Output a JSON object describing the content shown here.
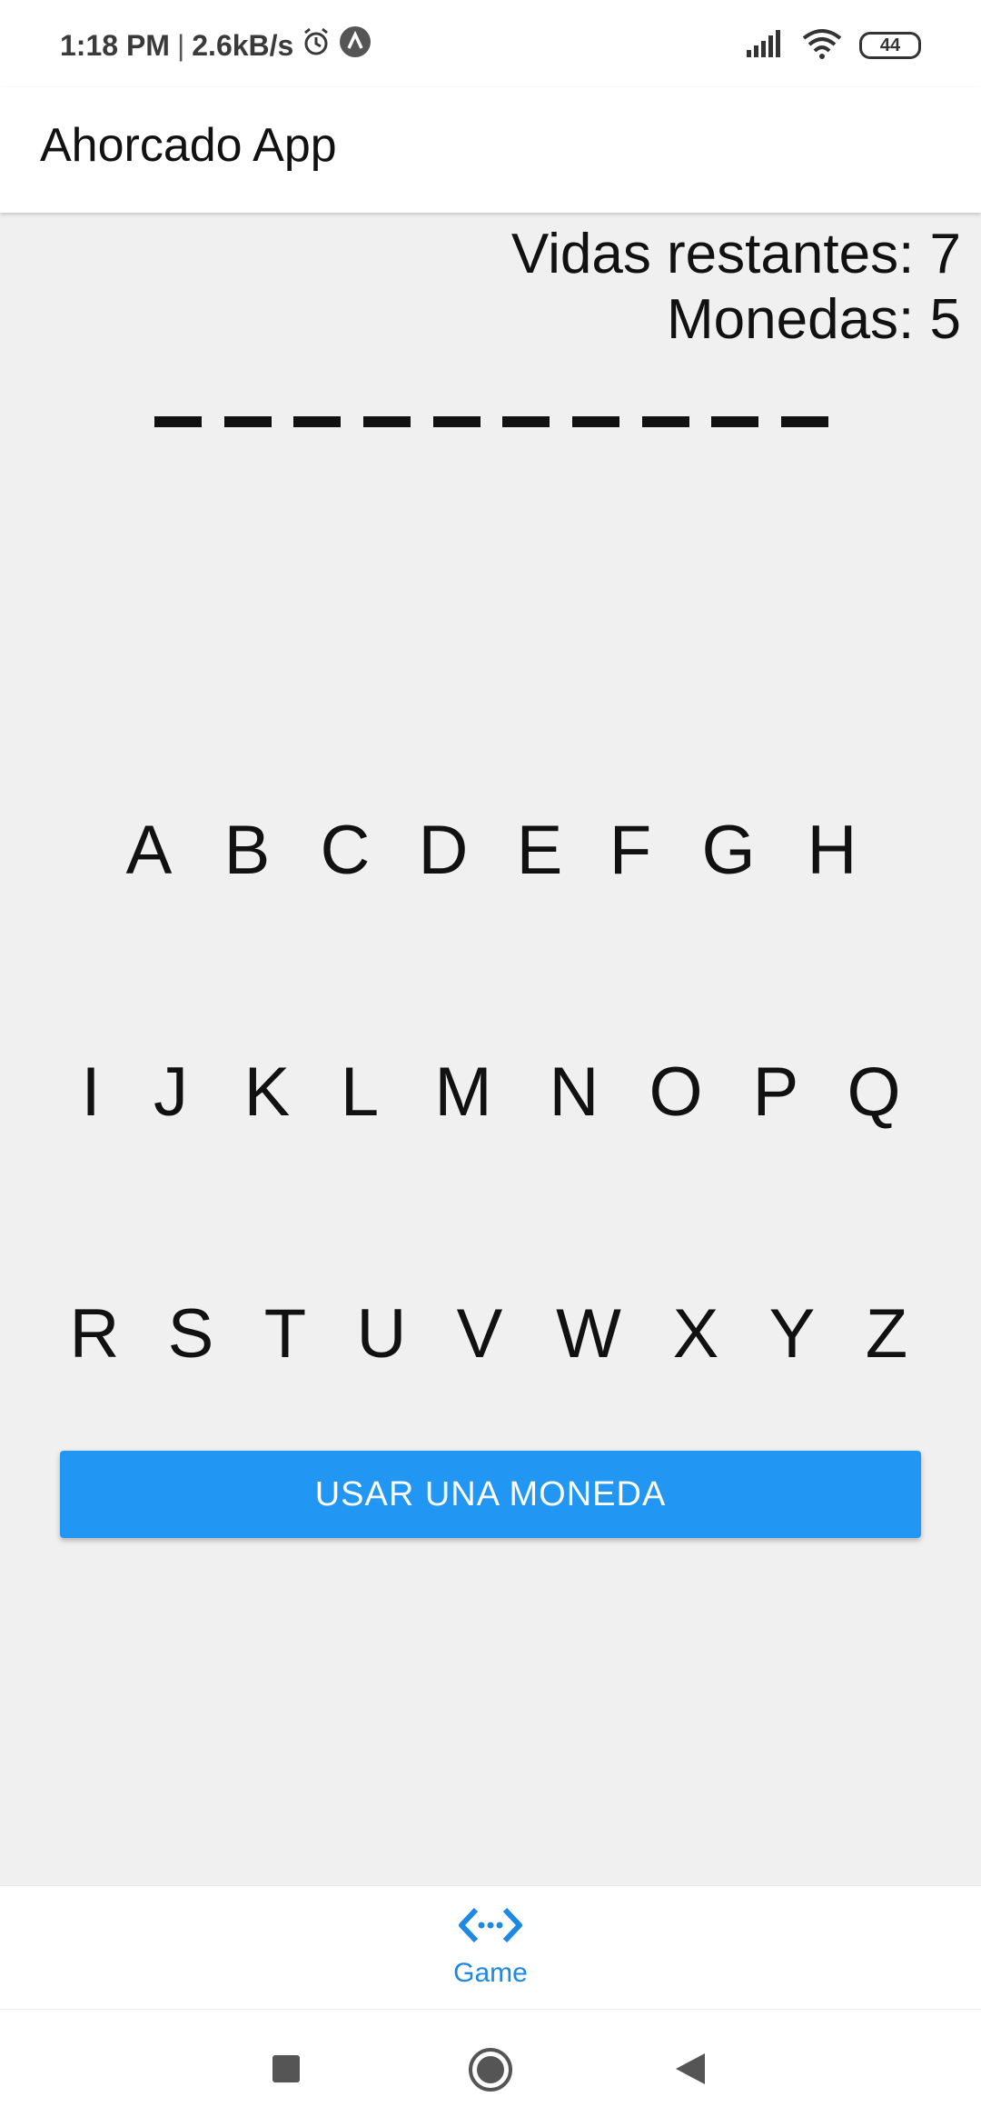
{
  "status_bar": {
    "time": "1:18 PM",
    "separator": "|",
    "network_speed": "2.6kB/s",
    "icons": [
      "alarm-icon",
      "app-notification-icon",
      "signal-icon",
      "wifi-icon"
    ],
    "battery": "44"
  },
  "app_bar": {
    "title": "Ahorcado App"
  },
  "stats": {
    "lives": "Vidas restantes: 7",
    "coins": "Monedas: 5"
  },
  "word": {
    "length": 10
  },
  "keyboard": {
    "rows": [
      [
        "A",
        "B",
        "C",
        "D",
        "E",
        "F",
        "G",
        "H"
      ],
      [
        "I",
        "J",
        "K",
        "L",
        "M",
        "N",
        "O",
        "P",
        "Q"
      ],
      [
        "R",
        "S",
        "T",
        "U",
        "V",
        "W",
        "X",
        "Y",
        "Z"
      ]
    ]
  },
  "coin_button": {
    "label": "USAR UNA MONEDA"
  },
  "bottom_nav": {
    "items": [
      {
        "label": "Game",
        "icon": "game-code-icon"
      }
    ],
    "accent_color": "#1e88e5"
  },
  "colors": {
    "background": "#f0f0f0",
    "button": "#2196f3",
    "text": "#111111"
  }
}
